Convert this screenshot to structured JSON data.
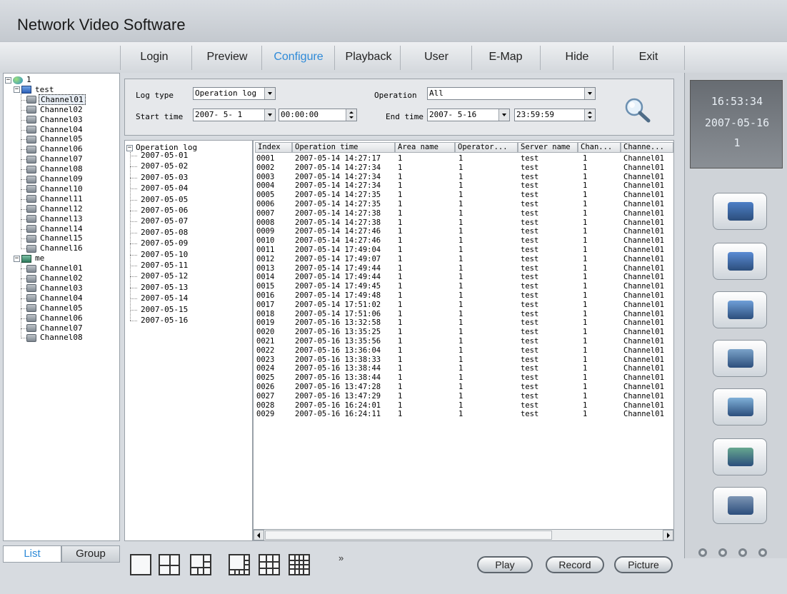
{
  "app": {
    "title": "Network Video Software"
  },
  "menu": {
    "items": [
      {
        "label": "Login",
        "active": false
      },
      {
        "label": "Preview",
        "active": false
      },
      {
        "label": "Configure",
        "active": true
      },
      {
        "label": "Playback",
        "active": false
      },
      {
        "label": "User",
        "active": false
      },
      {
        "label": "E-Map",
        "active": false
      },
      {
        "label": "Hide",
        "active": false
      },
      {
        "label": "Exit",
        "active": false
      }
    ]
  },
  "device_tree": {
    "root": "1",
    "groups": [
      {
        "name": "test",
        "channels": [
          "Channel01",
          "Channel02",
          "Channel03",
          "Channel04",
          "Channel05",
          "Channel06",
          "Channel07",
          "Channel08",
          "Channel09",
          "Channel10",
          "Channel11",
          "Channel12",
          "Channel13",
          "Channel14",
          "Channel15",
          "Channel16"
        ]
      },
      {
        "name": "me",
        "channels": [
          "Channel01",
          "Channel02",
          "Channel03",
          "Channel04",
          "Channel05",
          "Channel06",
          "Channel07",
          "Channel08"
        ]
      }
    ]
  },
  "bottom_tabs": {
    "list": "List",
    "group": "Group"
  },
  "filters": {
    "log_type_label": "Log type",
    "log_type_value": "Operation log",
    "operation_label": "Operation",
    "operation_value": "All",
    "start_time_label": "Start time",
    "start_date": "2007- 5- 1",
    "start_time": "00:00:00",
    "end_time_label": "End time",
    "end_date": "2007- 5-16",
    "end_time": "23:59:59"
  },
  "date_tree": {
    "root": "Operation log",
    "dates": [
      "2007-05-01",
      "2007-05-02",
      "2007-05-03",
      "2007-05-04",
      "2007-05-05",
      "2007-05-06",
      "2007-05-07",
      "2007-05-08",
      "2007-05-09",
      "2007-05-10",
      "2007-05-11",
      "2007-05-12",
      "2007-05-13",
      "2007-05-14",
      "2007-05-15",
      "2007-05-16"
    ]
  },
  "log_table": {
    "columns": [
      "Index",
      "Operation time",
      "Area name",
      "Operator...",
      "Server name",
      "Chan...",
      "Channe..."
    ],
    "rows": [
      [
        "0001",
        "2007-05-14 14:27:17",
        "1",
        "1",
        "test",
        "1",
        "Channel01"
      ],
      [
        "0002",
        "2007-05-14 14:27:34",
        "1",
        "1",
        "test",
        "1",
        "Channel01"
      ],
      [
        "0003",
        "2007-05-14 14:27:34",
        "1",
        "1",
        "test",
        "1",
        "Channel01"
      ],
      [
        "0004",
        "2007-05-14 14:27:34",
        "1",
        "1",
        "test",
        "1",
        "Channel01"
      ],
      [
        "0005",
        "2007-05-14 14:27:35",
        "1",
        "1",
        "test",
        "1",
        "Channel01"
      ],
      [
        "0006",
        "2007-05-14 14:27:35",
        "1",
        "1",
        "test",
        "1",
        "Channel01"
      ],
      [
        "0007",
        "2007-05-14 14:27:38",
        "1",
        "1",
        "test",
        "1",
        "Channel01"
      ],
      [
        "0008",
        "2007-05-14 14:27:38",
        "1",
        "1",
        "test",
        "1",
        "Channel01"
      ],
      [
        "0009",
        "2007-05-14 14:27:46",
        "1",
        "1",
        "test",
        "1",
        "Channel01"
      ],
      [
        "0010",
        "2007-05-14 14:27:46",
        "1",
        "1",
        "test",
        "1",
        "Channel01"
      ],
      [
        "0011",
        "2007-05-14 17:49:04",
        "1",
        "1",
        "test",
        "1",
        "Channel01"
      ],
      [
        "0012",
        "2007-05-14 17:49:07",
        "1",
        "1",
        "test",
        "1",
        "Channel01"
      ],
      [
        "0013",
        "2007-05-14 17:49:44",
        "1",
        "1",
        "test",
        "1",
        "Channel01"
      ],
      [
        "0014",
        "2007-05-14 17:49:44",
        "1",
        "1",
        "test",
        "1",
        "Channel01"
      ],
      [
        "0015",
        "2007-05-14 17:49:45",
        "1",
        "1",
        "test",
        "1",
        "Channel01"
      ],
      [
        "0016",
        "2007-05-14 17:49:48",
        "1",
        "1",
        "test",
        "1",
        "Channel01"
      ],
      [
        "0017",
        "2007-05-14 17:51:02",
        "1",
        "1",
        "test",
        "1",
        "Channel01"
      ],
      [
        "0018",
        "2007-05-14 17:51:06",
        "1",
        "1",
        "test",
        "1",
        "Channel01"
      ],
      [
        "0019",
        "2007-05-16 13:32:58",
        "1",
        "1",
        "test",
        "1",
        "Channel01"
      ],
      [
        "0020",
        "2007-05-16 13:35:25",
        "1",
        "1",
        "test",
        "1",
        "Channel01"
      ],
      [
        "0021",
        "2007-05-16 13:35:56",
        "1",
        "1",
        "test",
        "1",
        "Channel01"
      ],
      [
        "0022",
        "2007-05-16 13:36:04",
        "1",
        "1",
        "test",
        "1",
        "Channel01"
      ],
      [
        "0023",
        "2007-05-16 13:38:33",
        "1",
        "1",
        "test",
        "1",
        "Channel01"
      ],
      [
        "0024",
        "2007-05-16 13:38:44",
        "1",
        "1",
        "test",
        "1",
        "Channel01"
      ],
      [
        "0025",
        "2007-05-16 13:38:44",
        "1",
        "1",
        "test",
        "1",
        "Channel01"
      ],
      [
        "0026",
        "2007-05-16 13:47:28",
        "1",
        "1",
        "test",
        "1",
        "Channel01"
      ],
      [
        "0027",
        "2007-05-16 13:47:29",
        "1",
        "1",
        "test",
        "1",
        "Channel01"
      ],
      [
        "0028",
        "2007-05-16 16:24:01",
        "1",
        "1",
        "test",
        "1",
        "Channel01"
      ],
      [
        "0029",
        "2007-05-16 16:24:11",
        "1",
        "1",
        "test",
        "1",
        "Channel01"
      ]
    ]
  },
  "status": {
    "time": "16:53:34",
    "date": "2007-05-16",
    "channel": "1"
  },
  "side_buttons": [
    "device-config-icon",
    "local-config-icon",
    "remote-config-icon",
    "security-config-icon",
    "log-search-icon",
    "card-config-icon",
    "exit-config-icon"
  ],
  "playback_buttons": {
    "play": "Play",
    "record": "Record",
    "picture": "Picture"
  },
  "layout_more": "»"
}
